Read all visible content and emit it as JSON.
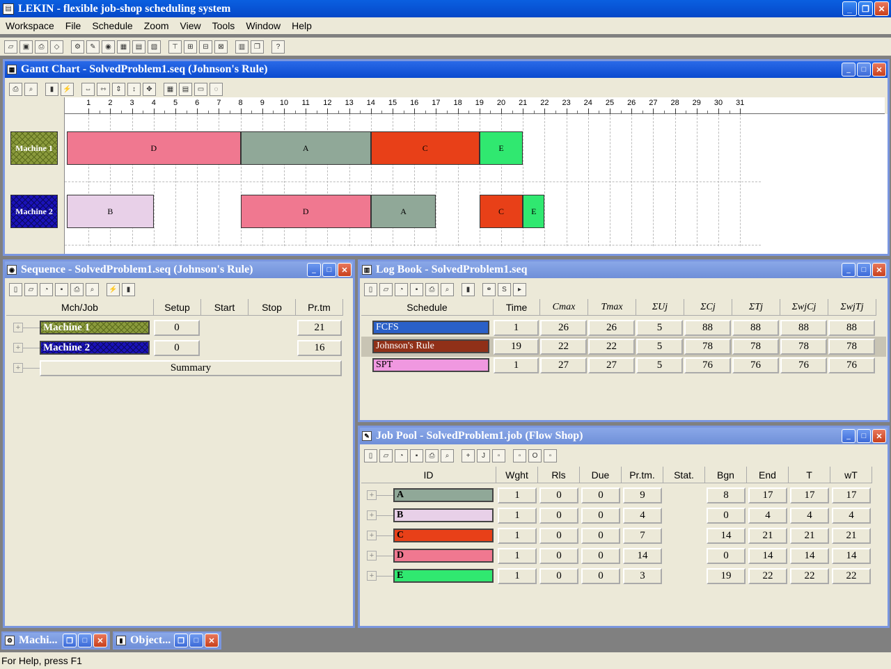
{
  "app": {
    "title": "LEKIN - flexible job-shop scheduling system"
  },
  "menu": [
    "Workspace",
    "File",
    "Schedule",
    "Zoom",
    "View",
    "Tools",
    "Window",
    "Help"
  ],
  "gantt": {
    "title": "Gantt Chart - SolvedProblem1.seq (Johnson's Rule)",
    "ticks": [
      "1",
      "2",
      "3",
      "4",
      "5",
      "6",
      "7",
      "8",
      "9",
      "10",
      "11",
      "12",
      "13",
      "14",
      "15",
      "16",
      "17",
      "18",
      "19",
      "20",
      "21",
      "22",
      "23",
      "24",
      "25",
      "26",
      "27",
      "28",
      "29",
      "30",
      "31"
    ],
    "machines": [
      {
        "label": "Machine 1",
        "bars": [
          {
            "job": "D",
            "start": 0,
            "end": 8,
            "color": "#f07890"
          },
          {
            "job": "A",
            "start": 8,
            "end": 14,
            "color": "#90a898"
          },
          {
            "job": "C",
            "start": 14,
            "end": 19,
            "color": "#e84018"
          },
          {
            "job": "E",
            "start": 19,
            "end": 21,
            "color": "#30e870"
          }
        ]
      },
      {
        "label": "Machine 2",
        "bars": [
          {
            "job": "B",
            "start": 0,
            "end": 4,
            "color": "#e8d0e8"
          },
          {
            "job": "D",
            "start": 8,
            "end": 14,
            "color": "#f07890"
          },
          {
            "job": "A",
            "start": 14,
            "end": 17,
            "color": "#90a898"
          },
          {
            "job": "C",
            "start": 19,
            "end": 21,
            "color": "#e84018"
          },
          {
            "job": "E",
            "start": 21,
            "end": 22,
            "color": "#30e870"
          }
        ]
      }
    ]
  },
  "sequence": {
    "title": "Sequence - SolvedProblem1.seq (Johnson's Rule)",
    "headers": [
      "Mch/Job",
      "Setup",
      "Start",
      "Stop",
      "Pr.tm"
    ],
    "rows": [
      {
        "name": "Machine 1",
        "setup": "0",
        "prtm": "21"
      },
      {
        "name": "Machine 2",
        "setup": "0",
        "prtm": "16"
      }
    ],
    "summary": "Summary"
  },
  "logbook": {
    "title": "Log Book - SolvedProblem1.seq",
    "headers": [
      "Schedule",
      "Time",
      "Cmax",
      "Tmax",
      "ΣUj",
      "ΣCj",
      "ΣTj",
      "ΣwjCj",
      "ΣwjTj"
    ],
    "rows": [
      {
        "name": "FCFS",
        "color": "#2a60c8",
        "cells": [
          "1",
          "26",
          "26",
          "5",
          "88",
          "88",
          "88",
          "88"
        ]
      },
      {
        "name": "Johnson's Rule",
        "color": "#903018",
        "cells": [
          "19",
          "22",
          "22",
          "5",
          "78",
          "78",
          "78",
          "78"
        ]
      },
      {
        "name": "SPT",
        "color": "#f098e0",
        "cells": [
          "1",
          "27",
          "27",
          "5",
          "76",
          "76",
          "76",
          "76"
        ]
      }
    ]
  },
  "jobpool": {
    "title": "Job Pool - SolvedProblem1.job (Flow Shop)",
    "headers": [
      "ID",
      "Wght",
      "Rls",
      "Due",
      "Pr.tm.",
      "Stat.",
      "Bgn",
      "End",
      "T",
      "wT"
    ],
    "rows": [
      {
        "id": "A",
        "color": "#90a898",
        "cells": [
          "1",
          "0",
          "0",
          "9",
          "",
          "8",
          "17",
          "17",
          "17"
        ]
      },
      {
        "id": "B",
        "color": "#e8d0e8",
        "cells": [
          "1",
          "0",
          "0",
          "4",
          "",
          "0",
          "4",
          "4",
          "4"
        ]
      },
      {
        "id": "C",
        "color": "#e84018",
        "cells": [
          "1",
          "0",
          "0",
          "7",
          "",
          "14",
          "21",
          "21",
          "21"
        ]
      },
      {
        "id": "D",
        "color": "#f07890",
        "cells": [
          "1",
          "0",
          "0",
          "14",
          "",
          "0",
          "14",
          "14",
          "14"
        ]
      },
      {
        "id": "E",
        "color": "#30e870",
        "cells": [
          "1",
          "0",
          "0",
          "3",
          "",
          "19",
          "22",
          "22",
          "22"
        ]
      }
    ]
  },
  "minimized": [
    "Machi...",
    "Object..."
  ],
  "status": "For Help, press F1"
}
